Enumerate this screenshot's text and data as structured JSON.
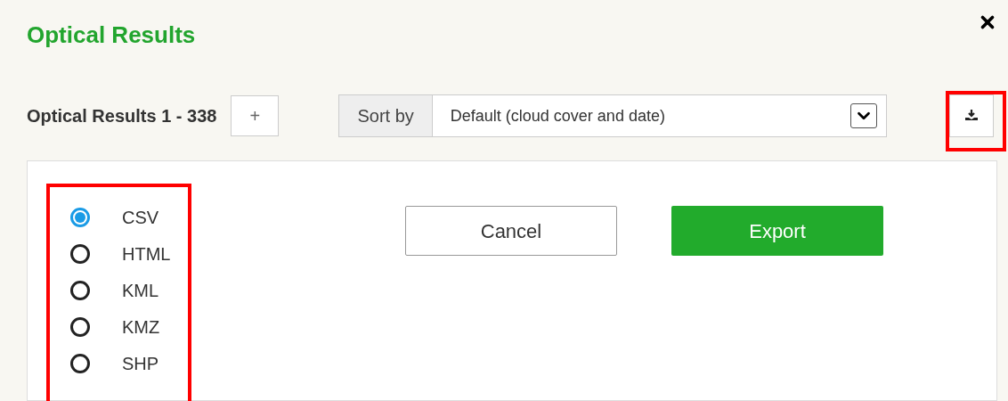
{
  "dialog": {
    "title": "Optical Results"
  },
  "toolbar": {
    "results_label": "Optical Results 1 - 338",
    "add_button": "+",
    "sort_label": "Sort by",
    "sort_value": "Default (cloud cover and date)",
    "export_highlighted": true
  },
  "export_panel": {
    "formats_highlighted": true,
    "formats": [
      {
        "label": "CSV",
        "selected": true
      },
      {
        "label": "HTML",
        "selected": false
      },
      {
        "label": "KML",
        "selected": false
      },
      {
        "label": "KMZ",
        "selected": false
      },
      {
        "label": "SHP",
        "selected": false
      }
    ],
    "buttons": [
      {
        "label": "Cancel",
        "kind": "secondary"
      },
      {
        "label": "Export",
        "kind": "primary"
      }
    ]
  }
}
